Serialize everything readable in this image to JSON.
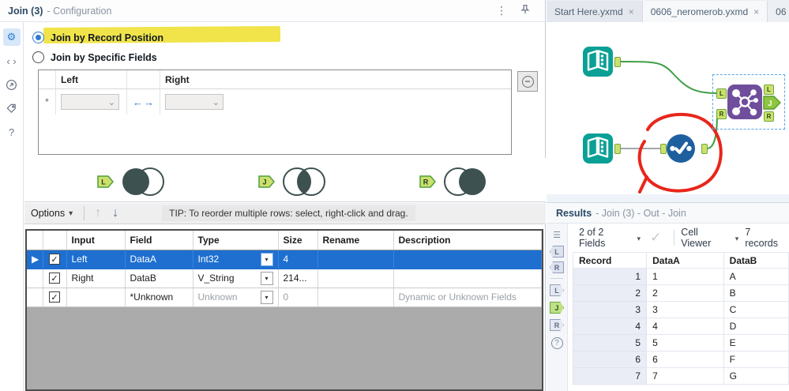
{
  "icons": {
    "more": "⋮",
    "gear": "⚙",
    "code": "‹ ›",
    "help": "?",
    "caret": "▾",
    "chev": "⌄",
    "check": "✓",
    "close": "×",
    "row_pointer": "▶",
    "swap_left": "←",
    "swap_right": "→",
    "up_arrow": "↑",
    "down_arrow": "↓",
    "minus": "−",
    "list": "☰",
    "row_marker": "*"
  },
  "config": {
    "title": "Join (3)",
    "subtitle": "- Configuration",
    "radios": {
      "record_position": "Join by Record Position",
      "specific_fields": "Join by Specific Fields"
    },
    "join_fields": {
      "left_header": "Left",
      "right_header": "Right"
    },
    "outputs": [
      {
        "letter": "L"
      },
      {
        "letter": "J"
      },
      {
        "letter": "R"
      }
    ],
    "toolbar": {
      "options": "Options",
      "tip": "TIP: To reorder multiple rows: select, right-click and drag."
    },
    "grid": {
      "headers": {
        "input": "Input",
        "field": "Field",
        "type": "Type",
        "size": "Size",
        "rename": "Rename",
        "description": "Description"
      },
      "rows": [
        {
          "input": "Left",
          "field": "DataA",
          "type": "Int32",
          "size": "4",
          "rename": "",
          "description": ""
        },
        {
          "input": "Right",
          "field": "DataB",
          "type": "V_String",
          "size": "214...",
          "rename": "",
          "description": ""
        },
        {
          "input": "",
          "field": "*Unknown",
          "type": "Unknown",
          "size": "0",
          "rename": "",
          "description": "Dynamic or Unknown Fields"
        }
      ]
    }
  },
  "workspace": {
    "tabs": [
      {
        "label": "Start Here.yxmd"
      },
      {
        "label": "0606_neromerob.yxmd"
      },
      {
        "label": "06"
      }
    ],
    "join_anchors": {
      "in_left": "L",
      "in_right": "R",
      "out_left": "L",
      "out_join": "J",
      "out_right": "R"
    }
  },
  "results": {
    "title": "Results",
    "subtitle": "- Join (3) - Out - Join",
    "toolbar": {
      "fields": "2 of 2 Fields",
      "cell_viewer": "Cell Viewer",
      "records": "7 records"
    },
    "anchors": {
      "in_left": "L",
      "in_right": "R",
      "out_left": "L",
      "out_join": "J",
      "out_right": "R"
    },
    "table": {
      "headers": {
        "record": "Record",
        "dataA": "DataA",
        "dataB": "DataB"
      },
      "rows": [
        {
          "record": "1",
          "dataA": "1",
          "dataB": "A"
        },
        {
          "record": "2",
          "dataA": "2",
          "dataB": "B"
        },
        {
          "record": "3",
          "dataA": "3",
          "dataB": "C"
        },
        {
          "record": "4",
          "dataA": "4",
          "dataB": "D"
        },
        {
          "record": "5",
          "dataA": "5",
          "dataB": "E"
        },
        {
          "record": "6",
          "dataA": "6",
          "dataB": "F"
        },
        {
          "record": "7",
          "dataA": "7",
          "dataB": "G"
        }
      ]
    }
  },
  "colors": {
    "accent_blue": "#1e6fd0",
    "anchor_green_fill": "#cde06e",
    "anchor_green_border": "#6fa83f",
    "venn_dark": "#3d5150",
    "highlight_yellow": "#f0e23b",
    "tool_purple": "#6f4e9c",
    "tool_teal": "#0aa095",
    "tool_blue": "#1e5f9e",
    "annotation_red": "#e8261b"
  }
}
